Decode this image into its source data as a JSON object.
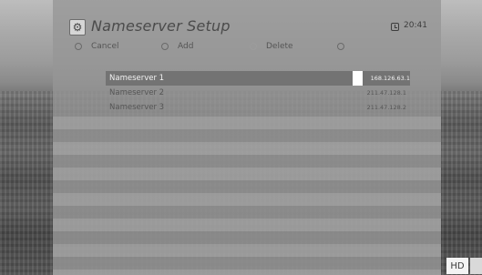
{
  "header": {
    "title": "Nameserver Setup",
    "time": "20:41",
    "icon": "gear-icon"
  },
  "actions": [
    {
      "label": "Cancel"
    },
    {
      "label": "Add"
    },
    {
      "label": "Delete"
    }
  ],
  "nameservers": [
    {
      "label": "Nameserver 1",
      "ip": "168.126.63.1",
      "selected": true
    },
    {
      "label": "Nameserver 2",
      "ip": "211.47.128.1",
      "selected": false
    },
    {
      "label": "Nameserver 3",
      "ip": "211.47.128.2",
      "selected": false
    }
  ],
  "badge": "HD"
}
